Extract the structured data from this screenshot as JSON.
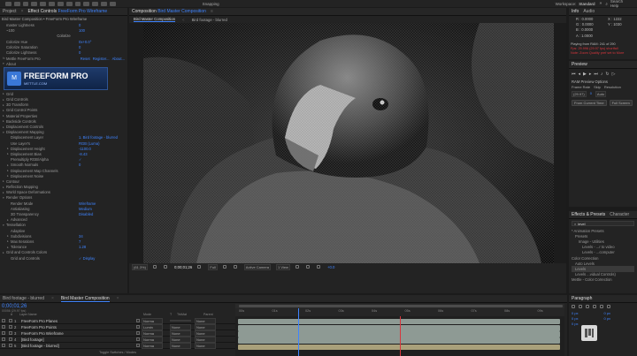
{
  "menubar": {
    "snapping": "Snapping",
    "workspace_label": "Workspace:",
    "workspace_value": "Standard",
    "search_label": "Search Help"
  },
  "left_panel": {
    "project_tab": "Project",
    "effect_controls_tab": "Effect Controls",
    "effect_controls_layer": "FreeForm Pro Wireframe",
    "breadcrumb": "Bird Master Composition • FreeForm Pro Wireframe",
    "top_rows": [
      {
        "label": "master Lightness",
        "value": "0"
      },
      {
        "label": "~100",
        "value": "100"
      }
    ],
    "colorize_label": "Colorize",
    "colorize_rows": [
      {
        "label": "Colorize Hue",
        "value": "0x+0.0°"
      },
      {
        "label": "Colorize Saturation",
        "value": "0"
      },
      {
        "label": "Colorize Lightness",
        "value": "0"
      }
    ],
    "plugin_name": "Mettle FreeForm Pro",
    "plugin_links": [
      "Reset",
      "Register...",
      "About..."
    ],
    "about_label": "About",
    "banner_brand": "FREEFORM PRO",
    "banner_site": "METTLE.COM",
    "rows": [
      {
        "tw": "▸",
        "label": "Grid",
        "value": "",
        "indent": 0
      },
      {
        "tw": "▸",
        "label": "Grid Controls",
        "value": "",
        "indent": 0
      },
      {
        "tw": "▸",
        "label": "3D Transform",
        "value": "",
        "indent": 0
      },
      {
        "tw": "▸",
        "label": "Grid Control Points",
        "value": "",
        "indent": 0
      },
      {
        "tw": "▸",
        "label": "Material Properties",
        "value": "",
        "indent": 0
      },
      {
        "tw": "▸",
        "label": "Backside Controls",
        "value": "",
        "indent": 0
      },
      {
        "tw": "▸",
        "label": "Displacement Controls",
        "value": "",
        "indent": 0
      },
      {
        "tw": "▾",
        "label": "Displacement Mapping",
        "value": "",
        "indent": 0
      },
      {
        "tw": "",
        "label": "Displacement Layer",
        "value": "1. Bird footage - blurred",
        "indent": 1
      },
      {
        "tw": "",
        "label": "Use Layer's",
        "value": "RGB (Luma)",
        "indent": 1
      },
      {
        "tw": "▸",
        "label": "Displacement Height",
        "value": "-1100.0",
        "indent": 1
      },
      {
        "tw": "▸",
        "label": "Displacement Bias",
        "value": "-8.43",
        "indent": 1
      },
      {
        "tw": "",
        "label": "Premultiply RGB/Alpha",
        "value": "✓",
        "indent": 1
      },
      {
        "tw": "▸",
        "label": "Smooth Normals",
        "value": "0",
        "indent": 1
      },
      {
        "tw": "▸",
        "label": "Displacement Map Channels",
        "value": "",
        "indent": 1
      },
      {
        "tw": "▸",
        "label": "Displacement Noise",
        "value": "",
        "indent": 1
      },
      {
        "tw": "▸",
        "label": "Contour",
        "value": "",
        "indent": 0
      },
      {
        "tw": "▸",
        "label": "Reflection Mapping",
        "value": "",
        "indent": 0
      },
      {
        "tw": "▸",
        "label": "World Space Deformations",
        "value": "",
        "indent": 0
      },
      {
        "tw": "▾",
        "label": "Render Options",
        "value": "",
        "indent": 0
      },
      {
        "tw": "",
        "label": "Render Mode",
        "value": "Wireframe",
        "indent": 1
      },
      {
        "tw": "",
        "label": "Antialiasing",
        "value": "Medium",
        "indent": 1
      },
      {
        "tw": "",
        "label": "3D Transparency",
        "value": "Disabled",
        "indent": 1
      },
      {
        "tw": "▸",
        "label": "Advanced",
        "value": "",
        "indent": 1
      },
      {
        "tw": "▾",
        "label": "Tessellation",
        "value": "",
        "indent": 0
      },
      {
        "tw": "",
        "label": "Adaptive",
        "value": "",
        "indent": 1
      },
      {
        "tw": "▸",
        "label": "Subdivisions",
        "value": "34",
        "indent": 1
      },
      {
        "tw": "▸",
        "label": "Max Iterations",
        "value": "7",
        "indent": 1
      },
      {
        "tw": "▸",
        "label": "Tolerance",
        "value": "1.28",
        "indent": 1
      },
      {
        "tw": "▸",
        "label": "Grid and Controls Colors",
        "value": "",
        "indent": 0
      },
      {
        "tw": "",
        "label": "Grid and Controls",
        "value": "✓ Display",
        "indent": 1
      }
    ]
  },
  "composition": {
    "tab_label": "Composition",
    "tab_name": "Bird Master Composition",
    "subtabs": [
      "Bird Master Composition",
      "Bird footage - blurred"
    ],
    "footer": {
      "zoom": "(61.3%)",
      "timecode": "0;00;01;26",
      "quality": "Full",
      "camera": "Active Camera",
      "views": "1 View",
      "exposure": "+0.0"
    }
  },
  "info_panel": {
    "tabs": [
      "Info",
      "Audio"
    ],
    "r_label": "R :",
    "r_value": "0.0000",
    "g_label": "G :",
    "g_value": "0.0000",
    "b_label": "B :",
    "b_value": "0.0000",
    "a_label": "A :",
    "a_value": "1.0000",
    "x_label": "X :",
    "x_value": "1222",
    "y_label": "Y :",
    "y_value": "1030",
    "status_lines": [
      "Playing from RAM: 241 of 290",
      "Fps: 29.996 (29.97 fps) shortfall",
      "Note: Zoom Quality pref set to More"
    ]
  },
  "preview_panel": {
    "title": "Preview",
    "ram_options": "RAM Preview Options",
    "frame_rate_label": "Frame Rate",
    "frame_rate_value": "(29.97)",
    "skip_label": "Skip",
    "skip_value": "0",
    "resolution_label": "Resolution",
    "resolution_value": "Auto",
    "from_current": "From Current Time",
    "full_screen": "Full Screen"
  },
  "effects_panel": {
    "tabs": [
      "Effects & Presets",
      "Character"
    ],
    "search": "level",
    "items": [
      {
        "label": "* Animation Presets",
        "indent": 0
      },
      {
        "label": "Presets",
        "indent": 1
      },
      {
        "label": "Image - Utilities",
        "indent": 2
      },
      {
        "label": "Levels - ...r to video",
        "indent": 3
      },
      {
        "label": "Levels - ...computer",
        "indent": 3
      },
      {
        "label": "Color Correction",
        "indent": 0
      },
      {
        "label": "Auto Levels",
        "indent": 1
      },
      {
        "label": "Levels",
        "indent": 1
      },
      {
        "label": "Levels ...vidual Controls)",
        "indent": 1
      },
      {
        "label": "Mettle - Color Correction",
        "indent": 0
      }
    ]
  },
  "paragraph_panel": {
    "title": "Paragraph",
    "fields": [
      "0 px",
      "0 px",
      "0 px",
      "0 px",
      "0 px"
    ]
  },
  "timeline": {
    "tabs": [
      "Bird footage - blurred",
      "Bird Master Composition"
    ],
    "timecode": "0;00;01;26",
    "timecode_sub": "00056 (29.97 fps)",
    "columns": [
      "#",
      "Layer Name",
      "Mode",
      "T",
      "TrkMat",
      "Parent"
    ],
    "ruler": [
      "00s",
      "01s",
      "02s",
      "03s",
      "04s",
      "05s",
      "06s",
      "07s",
      "08s",
      "09s"
    ],
    "layers": [
      {
        "num": "1",
        "name": "FreeForm Pro Planes",
        "mode": "Norma",
        "trkmat": "",
        "parent": "None"
      },
      {
        "num": "2",
        "name": "FreeForm Pro Points",
        "mode": "Lumin",
        "trkmat": "None",
        "parent": "None"
      },
      {
        "num": "3",
        "name": "FreeForm Pro Wireframe",
        "mode": "Norma",
        "trkmat": "None",
        "parent": "None"
      },
      {
        "num": "4",
        "name": "[Bird footage]",
        "mode": "Norma",
        "trkmat": "None",
        "parent": "None"
      },
      {
        "num": "5",
        "name": "[Bird footage - blurred]",
        "mode": "Norma",
        "trkmat": "None",
        "parent": "None"
      }
    ],
    "footer": "Toggle Switches / Modes"
  },
  "colors": {
    "accent": "#3f84ff",
    "playhead": "#d8363d",
    "layer_bar": "#8e9a94",
    "layer_bar_label": "#a9a07a"
  }
}
